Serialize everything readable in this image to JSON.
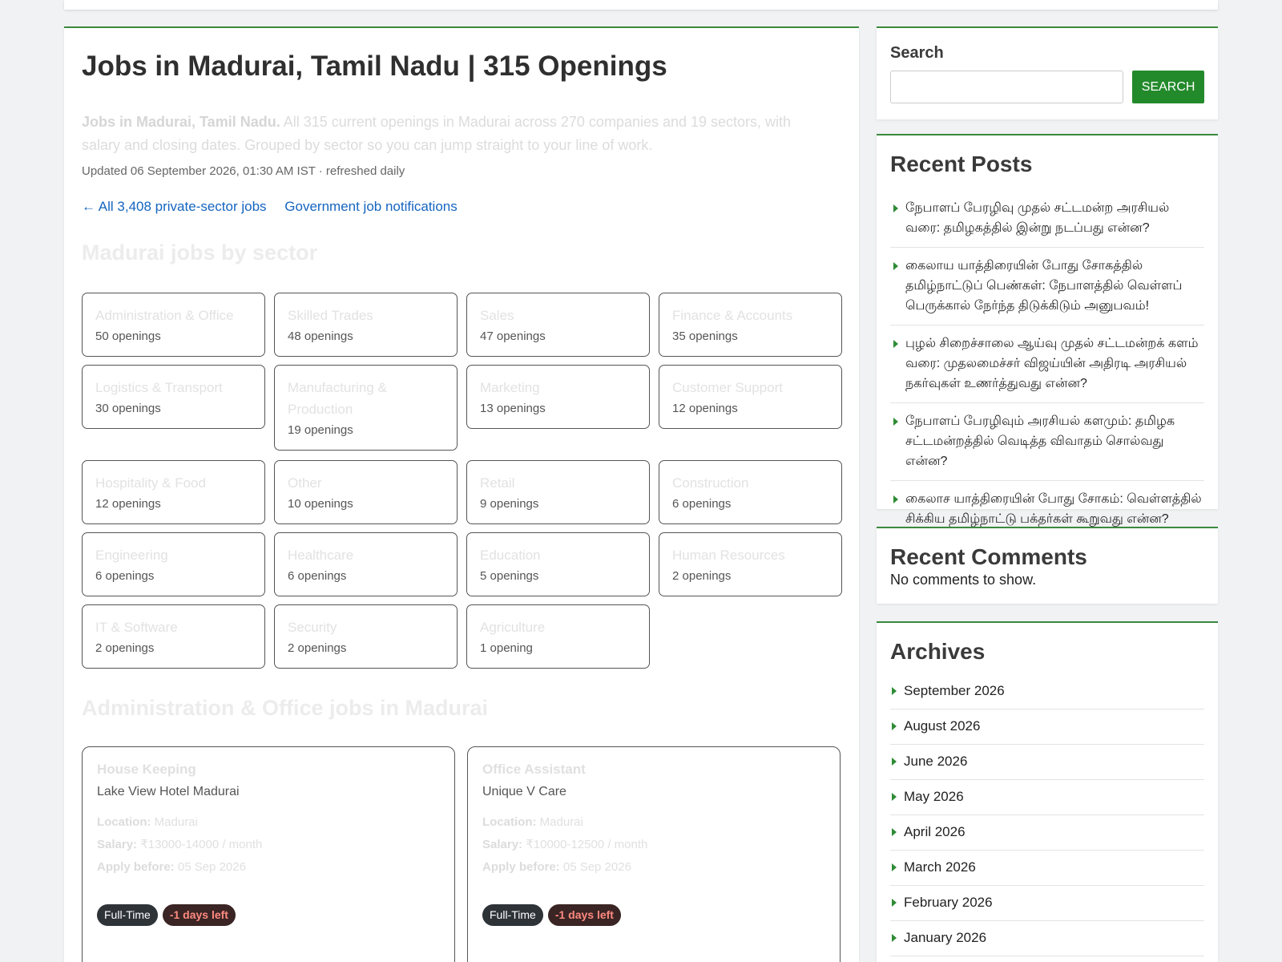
{
  "main": {
    "title": "Jobs in Madurai, Tamil Nadu | 315 Openings",
    "intro_bold": "Jobs in Madurai, Tamil Nadu.",
    "intro_rest": " All 315 current openings in Madurai across 270 companies and 19 sectors, with salary and closing dates. Grouped by sector so you can jump straight to your line of work.",
    "updated": "Updated 06 September 2026, 01:30 AM IST · refreshed daily",
    "links": [
      "← All 3,408 private-sector jobs",
      "Government job notifications"
    ],
    "sectors_heading": "Madurai jobs by sector",
    "sectors": [
      {
        "name": "Administration & Office",
        "count": "50 openings"
      },
      {
        "name": "Skilled Trades",
        "count": "48 openings"
      },
      {
        "name": "Sales",
        "count": "47 openings"
      },
      {
        "name": "Finance & Accounts",
        "count": "35 openings"
      },
      {
        "name": "Logistics & Transport",
        "count": "30 openings"
      },
      {
        "name": "Manufacturing & Production",
        "count": "19 openings"
      },
      {
        "name": "Marketing",
        "count": "13 openings"
      },
      {
        "name": "Customer Support",
        "count": "12 openings"
      },
      {
        "name": "Hospitality & Food",
        "count": "12 openings"
      },
      {
        "name": "Other",
        "count": "10 openings"
      },
      {
        "name": "Retail",
        "count": "9 openings"
      },
      {
        "name": "Construction",
        "count": "6 openings"
      },
      {
        "name": "Engineering",
        "count": "6 openings"
      },
      {
        "name": "Healthcare",
        "count": "6 openings"
      },
      {
        "name": "Education",
        "count": "5 openings"
      },
      {
        "name": "Human Resources",
        "count": "2 openings"
      },
      {
        "name": "IT & Software",
        "count": "2 openings"
      },
      {
        "name": "Security",
        "count": "2 openings"
      },
      {
        "name": "Agriculture",
        "count": "1 opening"
      }
    ],
    "jobs_heading": "Administration & Office jobs in Madurai",
    "jobs": [
      {
        "title": "House Keeping",
        "company": "Lake View Hotel Madurai",
        "location_label": "Location:",
        "location": " Madurai",
        "salary_label": "Salary:",
        "salary": " ₹13000-14000 / month",
        "apply_label": "Apply before:",
        "apply": " 05 Sep 2026",
        "type": "Full-Time",
        "days_left": "-1 days left"
      },
      {
        "title": "Office Assistant",
        "company": "Unique V Care",
        "location_label": "Location:",
        "location": " Madurai",
        "salary_label": "Salary:",
        "salary": " ₹10000-12500 / month",
        "apply_label": "Apply before:",
        "apply": " 05 Sep 2026",
        "type": "Full-Time",
        "days_left": "-1 days left"
      }
    ]
  },
  "sidebar": {
    "search": {
      "label": "Search",
      "button": "SEARCH",
      "value": ""
    },
    "recent_posts": {
      "title": "Recent Posts",
      "items": [
        "நேபாளப் பேரழிவு முதல் சட்டமன்ற அரசியல் வரை: தமிழகத்தில் இன்று நடப்பது என்ன?",
        "கைலாய யாத்திரையின் போது சோகத்தில் தமிழ்நாட்டுப் பெண்கள்: நேபாளத்தில் வெள்ளப் பெருக்கால் நேர்ந்த திடுக்கிடும் அனுபவம்!",
        "புழல் சிறைச்சாலை ஆய்வு முதல் சட்டமன்றக் களம் வரை: முதலமைச்சர் விஜய்யின் அதிரடி அரசியல் நகர்வுகள் உணர்த்துவது என்ன?",
        "நேபாளப் பேரழிவும் அரசியல் களமும்: தமிழக சட்டமன்றத்தில் வெடித்த விவாதம் சொல்வது என்ன?",
        "கைலாச யாத்திரையின் போது சோகம்: வெள்ளத்தில் சிக்கிய தமிழ்நாட்டு பக்தர்கள் கூறுவது என்ன?"
      ]
    },
    "recent_comments": {
      "title": "Recent Comments",
      "text": "No comments to show."
    },
    "archives": {
      "title": "Archives",
      "items": [
        "September 2026",
        "August 2026",
        "June 2026",
        "May 2026",
        "April 2026",
        "March 2026",
        "February 2026",
        "January 2026"
      ]
    }
  },
  "colors": {
    "accent_green": "#238a2b",
    "link_blue": "#1565c0",
    "days_left_red": "#ff8a80"
  }
}
